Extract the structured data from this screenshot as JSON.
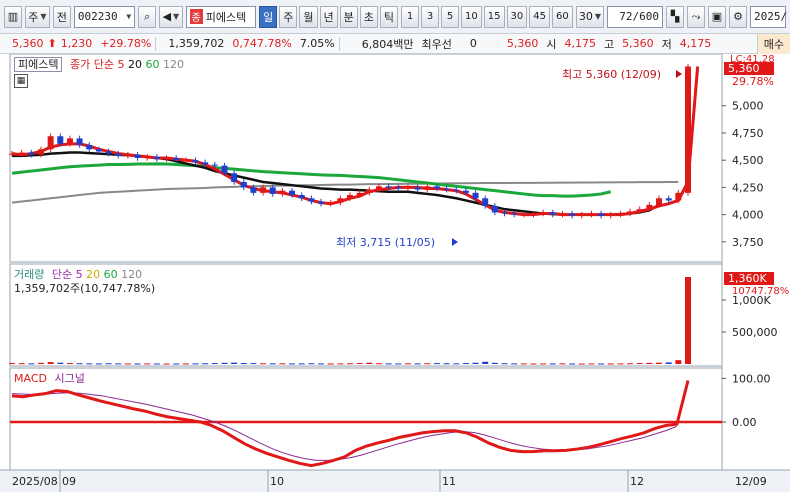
{
  "toolbar": {
    "stock_type": "주",
    "prev_label": "전",
    "code": "002230",
    "stock_name_badge": "종",
    "stock_name": "피에스텍",
    "periods": [
      "일",
      "주",
      "월",
      "년",
      "분",
      "초",
      "틱"
    ],
    "active_period": "일",
    "intervals": [
      "1",
      "3",
      "5",
      "10",
      "15",
      "30",
      "45",
      "60"
    ],
    "interval_value": "30",
    "count_value": "72/600",
    "date_value": "2025/"
  },
  "quote": {
    "price": "5,360",
    "change": "1,230",
    "change_pct": "+29.78%",
    "volume": "1,359,702",
    "volume_ratio": "0,747.78%",
    "turnover_pct": "7.05%",
    "amount": "6,804백만",
    "best_label": "최우선",
    "best_value": "0",
    "bid": "5,360",
    "open_label": "시",
    "open": "4,175",
    "high_label": "고",
    "high": "5,360",
    "low_label": "저",
    "low": "4,175",
    "buy_label": "매수"
  },
  "price_panel": {
    "name": "피에스텍",
    "legend_prefix": "종가 단순",
    "ma_periods": [
      "5",
      "20",
      "60",
      "120"
    ],
    "ma_colors": [
      "#e01818",
      "#111111",
      "#1aa83a",
      "#888888"
    ],
    "current_label": "5,360",
    "right_top_label": "LC:41.28",
    "pct_label": "29.78%",
    "y_ticks": [
      "5,000",
      "4,750",
      "4,500",
      "4,250",
      "4,000",
      "3,750"
    ],
    "high_annotation": "최고 5,360 (12/09)",
    "low_annotation": "최저 3,715 (11/05)"
  },
  "volume_panel": {
    "title": "거래량",
    "legend_prefix": "단순",
    "ma_periods": [
      "5",
      "20",
      "60",
      "120"
    ],
    "info": "1,359,702주(10,747.78%)",
    "current_label": "1,360K",
    "pct_label": "10747.78%",
    "y_ticks": [
      "1,000K",
      "500,000"
    ]
  },
  "macd_panel": {
    "title": "MACD",
    "signal_label": "시그널",
    "y_ticks": [
      "100.00",
      "0.00"
    ]
  },
  "x_axis": {
    "labels": [
      "2025/08",
      "09",
      "10",
      "11",
      "12",
      "12/09"
    ]
  },
  "chart_data": [
    {
      "type": "line",
      "title": "피에스텍 일봉",
      "y_axis_range": [
        3620,
        5420
      ],
      "close": [
        4560,
        4570,
        4550,
        4600,
        4720,
        4650,
        4700,
        4640,
        4600,
        4580,
        4560,
        4540,
        4550,
        4520,
        4530,
        4510,
        4520,
        4500,
        4500,
        4480,
        4460,
        4450,
        4380,
        4300,
        4250,
        4200,
        4250,
        4190,
        4220,
        4180,
        4150,
        4120,
        4100,
        4110,
        4150,
        4180,
        4200,
        4230,
        4260,
        4250,
        4240,
        4250,
        4230,
        4260,
        4240,
        4230,
        4220,
        4200,
        4150,
        4080,
        4020,
        4010,
        4000,
        4000,
        4010,
        4020,
        4000,
        4010,
        3990,
        4000,
        4010,
        3990,
        4000,
        4010,
        4030,
        4050,
        4090,
        4150,
        4130,
        4200,
        5360
      ],
      "ma5": [
        4560,
        4550,
        4560,
        4580,
        4620,
        4640,
        4650,
        4650,
        4630,
        4600,
        4580,
        4560,
        4550,
        4540,
        4530,
        4520,
        4520,
        4510,
        4500,
        4490,
        4460,
        4420,
        4370,
        4320,
        4270,
        4240,
        4220,
        4210,
        4200,
        4180,
        4160,
        4130,
        4110,
        4100,
        4120,
        4150,
        4170,
        4210,
        4230,
        4240,
        4250,
        4250,
        4250,
        4240,
        4240,
        4230,
        4220,
        4190,
        4140,
        4090,
        4040,
        4020,
        4010,
        4000,
        4000,
        4010,
        4010,
        4000,
        4000,
        4000,
        4000,
        4000,
        4000,
        4000,
        4010,
        4030,
        4050,
        4080,
        4100,
        4130,
        4300,
        5360
      ],
      "ma20": [
        4540,
        4540,
        4545,
        4550,
        4560,
        4565,
        4570,
        4570,
        4565,
        4560,
        4555,
        4550,
        4545,
        4540,
        4530,
        4520,
        4510,
        4490,
        4470,
        4450,
        4430,
        4400,
        4380,
        4360,
        4340,
        4320,
        4300,
        4290,
        4280,
        4270,
        4260,
        4250,
        4240,
        4235,
        4230,
        4230,
        4225,
        4220,
        4215,
        4210,
        4210,
        4210,
        4200,
        4190,
        4180,
        4165,
        4150,
        4130,
        4110,
        4090,
        4070,
        4050,
        4040,
        4030,
        4020,
        4010,
        4005,
        4000,
        4000,
        4000,
        4000,
        4000,
        4000,
        4005,
        4010,
        4020,
        4040,
        4090
      ],
      "ma60": [
        4380,
        4390,
        4400,
        4410,
        4420,
        4430,
        4440,
        4445,
        4450,
        4455,
        4460,
        4460,
        4462,
        4465,
        4465,
        4466,
        4465,
        4460,
        4455,
        4450,
        4440,
        4432,
        4425,
        4418,
        4410,
        4402,
        4395,
        4390,
        4385,
        4380,
        4375,
        4370,
        4365,
        4362,
        4360,
        4355,
        4350,
        4345,
        4340,
        4330,
        4320,
        4310,
        4300,
        4290,
        4280,
        4270,
        4260,
        4250,
        4240,
        4230,
        4220,
        4210,
        4200,
        4190,
        4180,
        4175,
        4175,
        4170,
        4170,
        4175,
        4180,
        4190,
        4210
      ],
      "ma120": [
        4110,
        4120,
        4130,
        4140,
        4150,
        4160,
        4170,
        4180,
        4190,
        4200,
        4205,
        4210,
        4215,
        4220,
        4225,
        4230,
        4235,
        4238,
        4240,
        4242,
        4245,
        4250,
        4252,
        4255,
        4258,
        4260,
        4262,
        4265,
        4266,
        4268,
        4270,
        4270,
        4272,
        4274,
        4275,
        4276,
        4278,
        4280,
        4280,
        4281,
        4282,
        4283,
        4284,
        4285,
        4286,
        4287,
        4288,
        4288,
        4289,
        4290,
        4290,
        4290,
        4291,
        4292,
        4292,
        4293,
        4293,
        4294,
        4294,
        4295,
        4295,
        4296,
        4296,
        4297,
        4297,
        4298,
        4298,
        4299,
        4300,
        4300
      ]
    },
    {
      "type": "bar",
      "title": "거래량",
      "y_axis_range": [
        0,
        1500000
      ],
      "values": [
        15000,
        12000,
        10000,
        18000,
        30000,
        20000,
        15000,
        12000,
        10000,
        9000,
        12000,
        10000,
        9000,
        8000,
        9000,
        8000,
        7000,
        8000,
        9000,
        10000,
        12000,
        15000,
        18000,
        22000,
        15000,
        14000,
        12000,
        10000,
        11000,
        9000,
        10000,
        12000,
        9000,
        8000,
        10000,
        12000,
        15000,
        20000,
        12000,
        10000,
        9000,
        11000,
        10000,
        12000,
        14000,
        12000,
        10000,
        15000,
        20000,
        35000,
        18000,
        12000,
        10000,
        9000,
        8000,
        9000,
        8000,
        10000,
        8000,
        7000,
        9000,
        8000,
        9000,
        10000,
        12000,
        15000,
        18000,
        20000,
        25000,
        60000,
        1359702
      ]
    },
    {
      "type": "line",
      "title": "MACD",
      "y_axis_range": [
        -110,
        110
      ],
      "macd": [
        60,
        58,
        62,
        65,
        72,
        70,
        62,
        55,
        48,
        42,
        36,
        30,
        25,
        18,
        12,
        8,
        4,
        0,
        -8,
        -20,
        -35,
        -50,
        -62,
        -72,
        -80,
        -88,
        -95,
        -100,
        -95,
        -88,
        -80,
        -65,
        -55,
        -48,
        -42,
        -35,
        -30,
        -25,
        -22,
        -20,
        -20,
        -25,
        -35,
        -48,
        -58,
        -65,
        -68,
        -68,
        -66,
        -66,
        -65,
        -62,
        -58,
        -52,
        -45,
        -38,
        -32,
        -25,
        -15,
        -8,
        -5,
        95
      ],
      "signal": [
        65,
        64,
        63,
        64,
        66,
        67,
        66,
        63,
        60,
        55,
        50,
        45,
        40,
        34,
        28,
        22,
        16,
        8,
        0,
        -10,
        -22,
        -35,
        -48,
        -60,
        -70,
        -78,
        -84,
        -88,
        -88,
        -86,
        -82,
        -76,
        -68,
        -60,
        -52,
        -45,
        -38,
        -32,
        -28,
        -24,
        -22,
        -24,
        -30,
        -38,
        -46,
        -53,
        -58,
        -62,
        -64,
        -65,
        -64,
        -62,
        -58,
        -54,
        -48,
        -42,
        -36,
        -28,
        -20,
        -10
      ]
    }
  ]
}
